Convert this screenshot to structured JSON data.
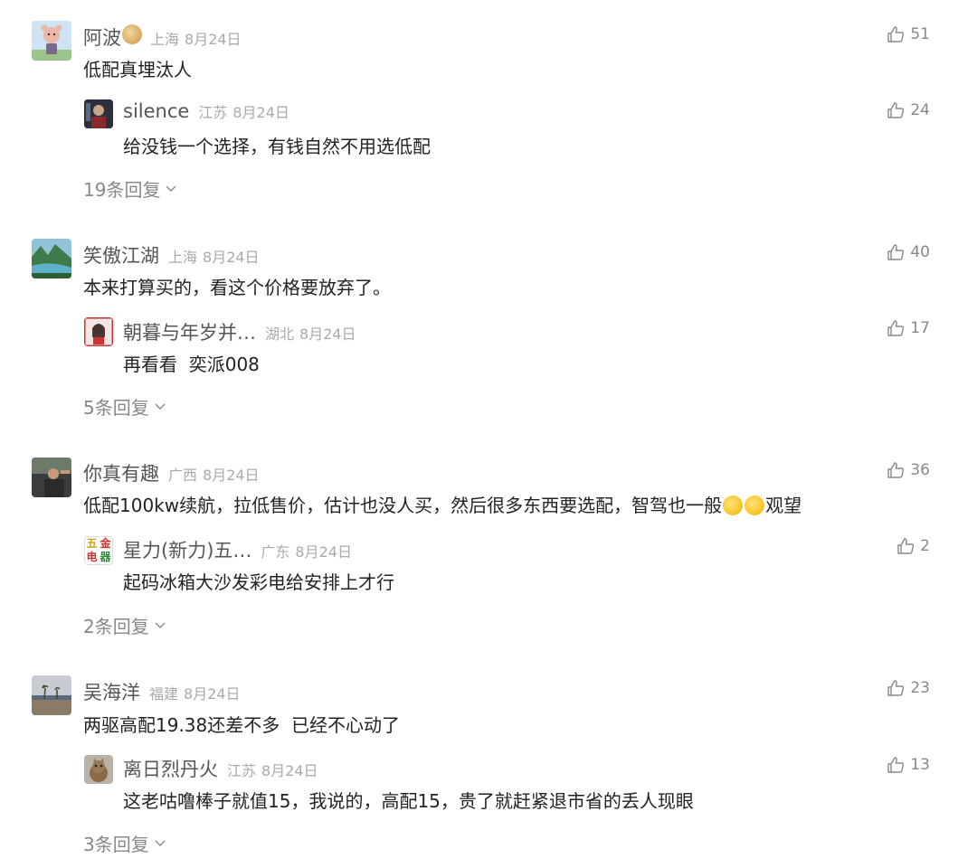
{
  "threads": [
    {
      "user": "阿波",
      "location": "上海",
      "date": "8月24日",
      "likes": "51",
      "text": "低配真埋汰人",
      "reply": {
        "user": "silence",
        "location": "江苏",
        "date": "8月24日",
        "likes": "24",
        "text": "给没钱一个选择，有钱自然不用选低配"
      },
      "more": "19条回复"
    },
    {
      "user": "笑傲江湖",
      "location": "上海",
      "date": "8月24日",
      "likes": "40",
      "text": "本来打算买的，看这个价格要放弃了。",
      "reply": {
        "user": "朝暮与年岁并…",
        "location": "湖北",
        "date": "8月24日",
        "likes": "17",
        "text": "再看看  奕派008"
      },
      "more": "5条回复"
    },
    {
      "user": "你真有趣",
      "location": "广西",
      "date": "8月24日",
      "likes": "36",
      "text_a": "低配100kw续航，拉低售价，估计也没人买，然后很多东西要选配，智驾也一般",
      "text_b": "观望",
      "reply": {
        "user": "星力(新力)五…",
        "location": "广东",
        "date": "8月24日",
        "likes": "2",
        "text": "起码冰箱大沙发彩电给安排上才行",
        "avatar_text": [
          "五",
          "金",
          "电",
          "器"
        ]
      },
      "more": "2条回复"
    },
    {
      "user": "吴海洋",
      "location": "福建",
      "date": "8月24日",
      "likes": "23",
      "text": "两驱高配19.38还差不多  已经不心动了",
      "reply": {
        "user": "离日烈丹火",
        "location": "江苏",
        "date": "8月24日",
        "likes": "13",
        "text": "这老咕噜棒子就值15，我说的，高配15，贵了就赶紧退市省的丢人现眼"
      },
      "more": "3条回复"
    }
  ]
}
